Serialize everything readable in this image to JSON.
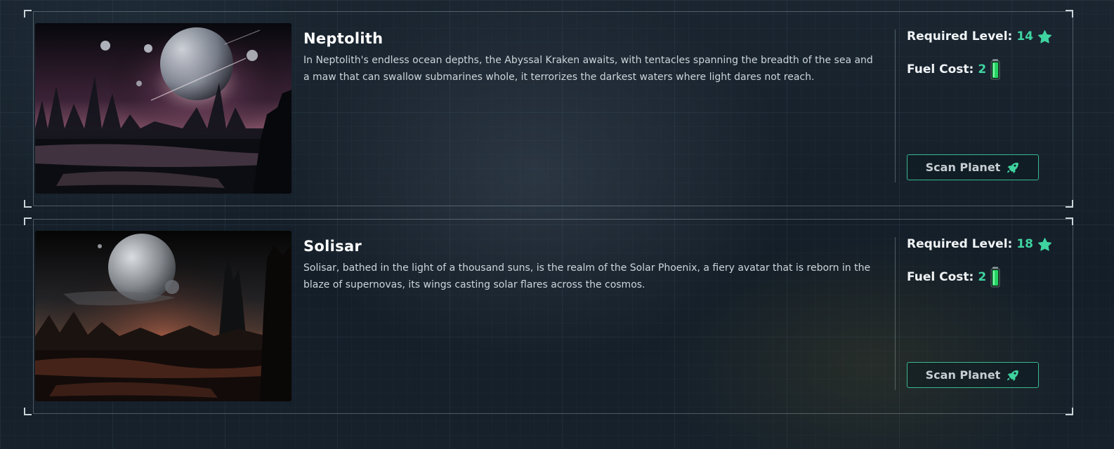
{
  "colors": {
    "accent": "#3fd3a0",
    "button_border": "#3ab88f",
    "text": "#ffffff",
    "muted_text": "#cdd5da"
  },
  "planets": [
    {
      "name": "Neptolith",
      "description": "In Neptolith's endless ocean depths, the Abyssal Kraken awaits, with tentacles spanning the breadth of the sea and a maw that can swallow submarines whole, it terrorizes the darkest waters where light dares not reach.",
      "required_level_label": "Required Level:",
      "required_level": "14",
      "fuel_cost_label": "Fuel Cost:",
      "fuel_cost": "2",
      "button_label": "Scan Planet",
      "level_icon": "star-icon",
      "fuel_icon": "fuel-canister-icon",
      "button_icon": "rocket-icon"
    },
    {
      "name": "Solisar",
      "description": "Solisar, bathed in the light of a thousand suns, is the realm of the Solar Phoenix, a fiery avatar that is reborn in the blaze of supernovas, its wings casting solar flares across the cosmos.",
      "required_level_label": "Required Level:",
      "required_level": "18",
      "fuel_cost_label": "Fuel Cost:",
      "fuel_cost": "2",
      "button_label": "Scan Planet",
      "level_icon": "star-icon",
      "fuel_icon": "fuel-canister-icon",
      "button_icon": "rocket-icon"
    }
  ]
}
